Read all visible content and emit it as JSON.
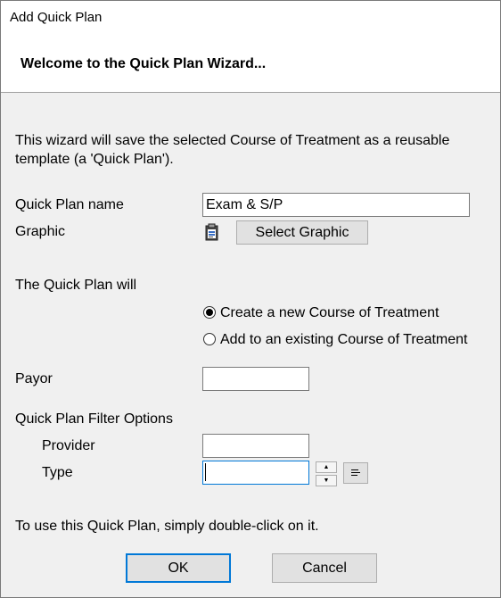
{
  "window": {
    "title": "Add Quick Plan"
  },
  "header": {
    "title": "Welcome to the Quick Plan Wizard..."
  },
  "description": "This wizard will save the selected Course of Treatment as a reusable template (a 'Quick Plan').",
  "fields": {
    "quick_plan_name_label": "Quick Plan name",
    "quick_plan_name_value": "Exam & S/P",
    "graphic_label": "Graphic",
    "select_graphic_label": "Select Graphic",
    "quick_plan_will_label": "The Quick Plan will",
    "radio_new_label": "Create a new Course of Treatment",
    "radio_existing_label": "Add to an existing Course of Treatment",
    "radio_selected": "new",
    "payor_label": "Payor",
    "payor_value": "",
    "filter_options_label": "Quick Plan Filter Options",
    "provider_label": "Provider",
    "provider_value": "",
    "type_label": "Type",
    "type_value": ""
  },
  "footer": {
    "hint": "To use this Quick Plan, simply double-click on it.",
    "ok_label": "OK",
    "cancel_label": "Cancel"
  },
  "icons": {
    "graphic": "clipboard-icon",
    "spin_up": "arrow-up-icon",
    "spin_down": "arrow-down-icon",
    "type_list": "list-icon"
  },
  "colors": {
    "focus_border": "#0078d7",
    "header_bg": "#ffffff",
    "dialog_bg": "#f0f0f0"
  }
}
